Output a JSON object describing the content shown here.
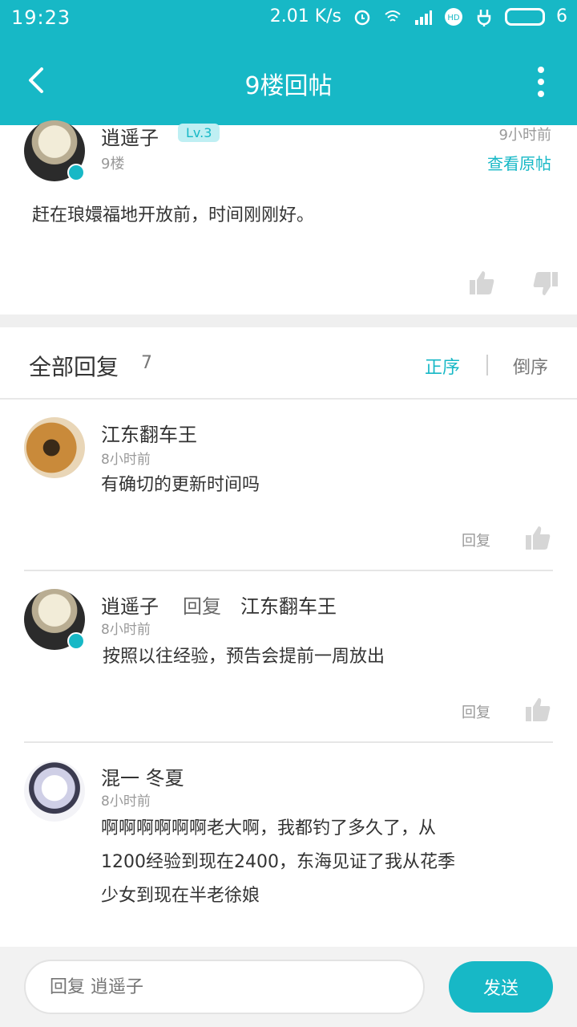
{
  "status_bar": {
    "time": "19:23",
    "speed": "2.01 K/s",
    "battery": "6"
  },
  "header": {
    "title": "9楼回帖"
  },
  "post": {
    "author": "逍遥子",
    "level": "Lv.3",
    "floor": "9楼",
    "time": "9小时前",
    "view_original": "查看原帖",
    "content": "赶在琅嬛福地开放前，时间刚刚好。"
  },
  "replies_section": {
    "title": "全部回复",
    "count": "7",
    "sort_asc": "正序",
    "sort_desc": "倒序",
    "items": [
      {
        "author": "江东翻车王",
        "time": "8小时前",
        "content": "有确切的更新时间吗",
        "reply_label": "回复"
      },
      {
        "author": "逍遥子",
        "reply_word": "回复",
        "reply_to": "江东翻车王",
        "time": "8小时前",
        "content": "按照以往经验，预告会提前一周放出",
        "reply_label": "回复"
      },
      {
        "author": "混一 冬夏",
        "time": "8小时前",
        "content_lines": [
          "啊啊啊啊啊啊老大啊，我都钓了多久了，从",
          "1200经验到现在2400，东海见证了我从花季",
          "少女到现在半老徐娘"
        ]
      }
    ]
  },
  "bottom_bar": {
    "placeholder": "回复 逍遥子",
    "send_label": "发送"
  },
  "colors": {
    "accent": "#17b8c6"
  }
}
